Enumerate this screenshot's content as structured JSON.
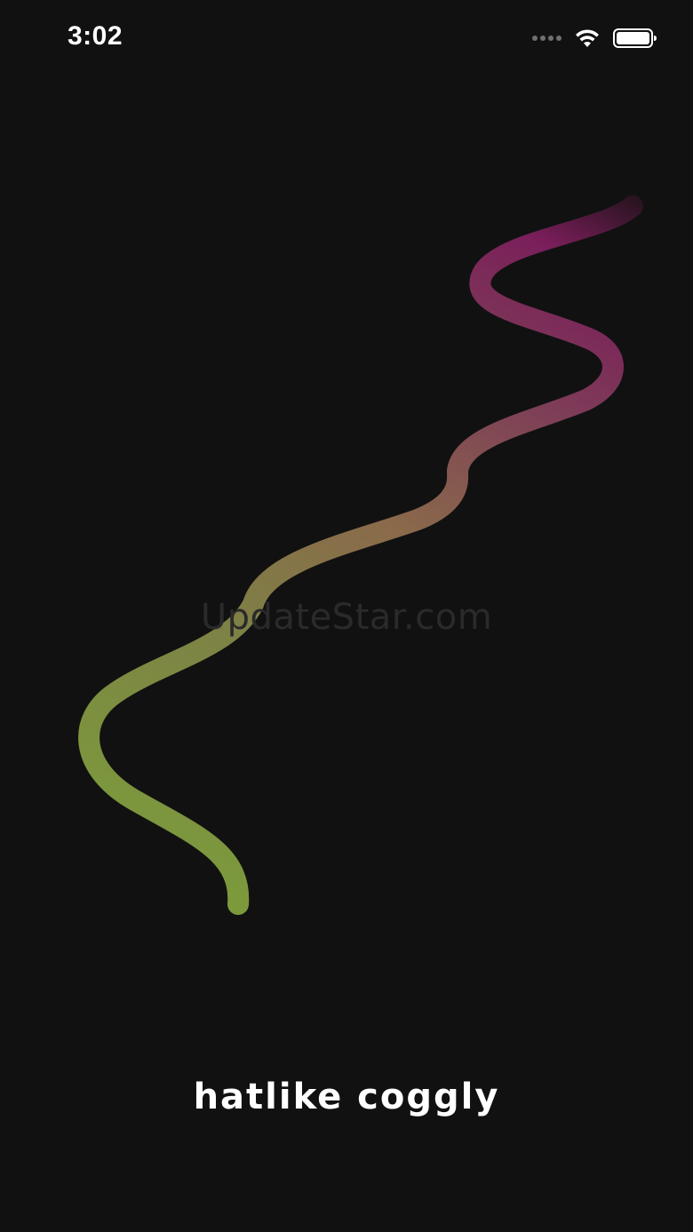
{
  "status_bar": {
    "time": "3:02",
    "icons": [
      "signal-dots-icon",
      "wifi-icon",
      "battery-icon"
    ]
  },
  "watermark": {
    "text": "UpdateStar.com"
  },
  "app": {
    "title": "hatlike coggly"
  },
  "colors": {
    "background": "#111111",
    "squiggle_start": "#7c9a3c",
    "squiggle_mid": "#8a6a4a",
    "squiggle_end": "#7a1e5a",
    "title": "#ffffff"
  }
}
